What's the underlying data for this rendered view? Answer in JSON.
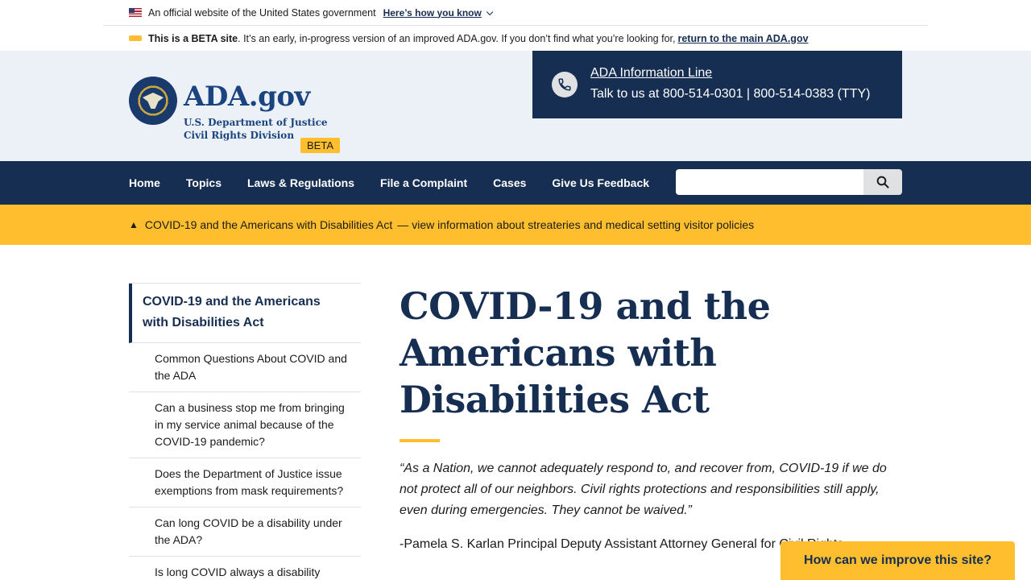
{
  "gov_banner": {
    "text": "An official website of the United States government",
    "link": "Here’s how you know"
  },
  "beta_banner": {
    "lead": "This is a BETA site",
    "text": ". It’s an early, in-progress version of an improved ADA.gov. If you don’t find what you’re looking for,",
    "link": "return to the main ADA.gov"
  },
  "header": {
    "logo": "ADA.gov",
    "badge": "BETA",
    "dept_line1": "U.S. Department of Justice",
    "dept_line2": "Civil Rights Division",
    "info_title": "ADA Information Line",
    "info_phones": "Talk to us at 800-514-0301 | 800-514-0383 (TTY)"
  },
  "nav": {
    "items": [
      "Home",
      "Topics",
      "Laws & Regulations",
      "File a Complaint",
      "Cases",
      "Give Us Feedback"
    ],
    "search_placeholder": ""
  },
  "alert": {
    "title": "COVID-19 and the Americans with Disabilities Act",
    "sep": "—",
    "text": "view information about streateries and medical setting visitor policies"
  },
  "sidenav": {
    "current": "COVID-19 and the Americans with Disabilities Act",
    "items": [
      "Common Questions About COVID and the ADA",
      "Can a business stop me from bringing in my service animal because of the COVID-19 pandemic?",
      "Does the Department of Justice issue exemptions from mask requirements?",
      "Can long COVID be a disability under the ADA?",
      "Is long COVID always a disability"
    ]
  },
  "content": {
    "title": "COVID-19 and the Americans with Disabilities Act",
    "quote": "“As a Nation, we cannot adequately respond to, and recover from, COVID-19 if we do not protect all of our neighbors. Civil rights protections and responsibilities still apply, even during emergencies. They cannot be waived.”",
    "attribution": "-Pamela S. Karlan Principal Deputy Assistant Attorney General for Civil Rights"
  },
  "feedback_button": "How can we improve this site?",
  "colors": {
    "navy": "#162e51",
    "gold": "#ffbe2e",
    "header_bg": "#ecf1f7"
  }
}
